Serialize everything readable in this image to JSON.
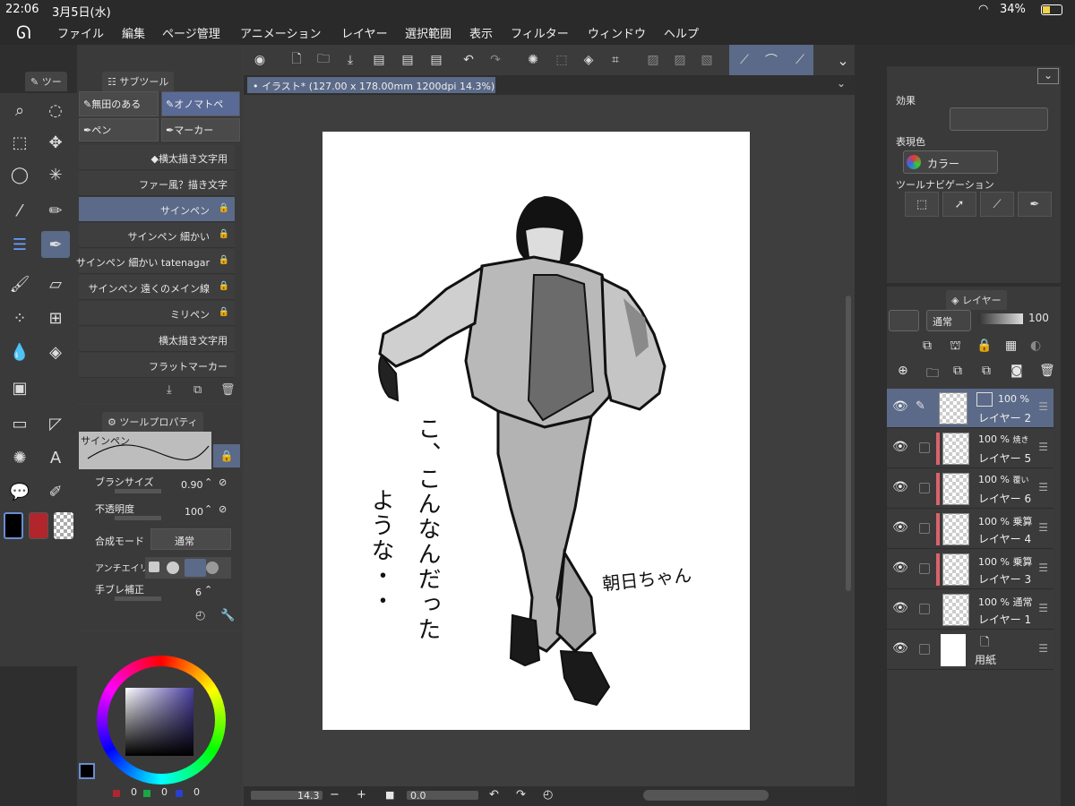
{
  "status": {
    "time": "22:06",
    "date": "3月5日(水)",
    "battery": "34%"
  },
  "menu": [
    "ファイル",
    "編集",
    "ページ管理",
    "アニメーション",
    "レイヤー",
    "選択範囲",
    "表示",
    "フィルター",
    "ウィンドウ",
    "ヘルプ"
  ],
  "tool_panel": {
    "tab_label": "ツー"
  },
  "subtool": {
    "tab_label": "サブツール",
    "groups": [
      "無田のある",
      "オノマトペ",
      "ペン",
      "マーカー"
    ],
    "brushes": [
      {
        "label": "◆横太描き文字用",
        "locked": false
      },
      {
        "label": "ファー風？描き文字",
        "locked": false
      },
      {
        "label": "サインペン",
        "locked": true
      },
      {
        "label": "サインペン 細かい",
        "locked": true
      },
      {
        "label": "サインペン 細かい tatenagar",
        "locked": true
      },
      {
        "label": "サインペン 遠くのメイン線",
        "locked": true
      },
      {
        "label": "ミリペン",
        "locked": true
      },
      {
        "label": "横太描き文字用",
        "locked": false
      },
      {
        "label": "フラットマーカー",
        "locked": false
      }
    ]
  },
  "tool_property": {
    "tab_label": "ツールプロパティ",
    "preset_name": "サインペン",
    "brush_size_label": "ブラシサイズ",
    "brush_size": "0.90",
    "opacity_label": "不透明度",
    "opacity": "100",
    "blend_label": "合成モード",
    "blend_value": "通常",
    "antialias_label": "アンチエイリ",
    "stabilization_label": "手ブレ補正",
    "stabilization": "6"
  },
  "color": {
    "r": "0",
    "g": "0",
    "b": "0",
    "main": "#000000",
    "sub": "#b0262c",
    "hue_indicator": "#4a3fa0"
  },
  "canvas": {
    "tab_title": "イラスト* (127.00 x 178.00mm 1200dpi 14.3%)",
    "zoom": "14.3",
    "rotation": "0.0",
    "vertical_text_1": "こ、こんなんだった",
    "vertical_text_2": "ような・・",
    "signature": "朝日ちゃん"
  },
  "right_top": {
    "effect_label": "効果",
    "expression_label": "表現色",
    "expression_value": "カラー",
    "tool_nav_label": "ツールナビゲーション"
  },
  "layers_panel": {
    "tab_label": "レイヤー",
    "blend_mode": "通常",
    "opacity": "100",
    "layers": [
      {
        "pct": "100 %",
        "mode": "",
        "name": "レイヤー 2",
        "selected": true,
        "red": false
      },
      {
        "pct": "100 %",
        "mode": "焼き",
        "name": "レイヤー 5",
        "selected": false,
        "red": true
      },
      {
        "pct": "100 %",
        "mode": "覆い",
        "name": "レイヤー 6",
        "selected": false,
        "red": true
      },
      {
        "pct": "100 %",
        "mode": "乗算",
        "name": "レイヤー 4",
        "selected": false,
        "red": true
      },
      {
        "pct": "100 %",
        "mode": "乗算",
        "name": "レイヤー 3",
        "selected": false,
        "red": true
      },
      {
        "pct": "100 %",
        "mode": "通常",
        "name": "レイヤー 1",
        "selected": false,
        "red": false
      },
      {
        "pct": "",
        "mode": "",
        "name": "用紙",
        "selected": false,
        "red": false
      }
    ]
  }
}
